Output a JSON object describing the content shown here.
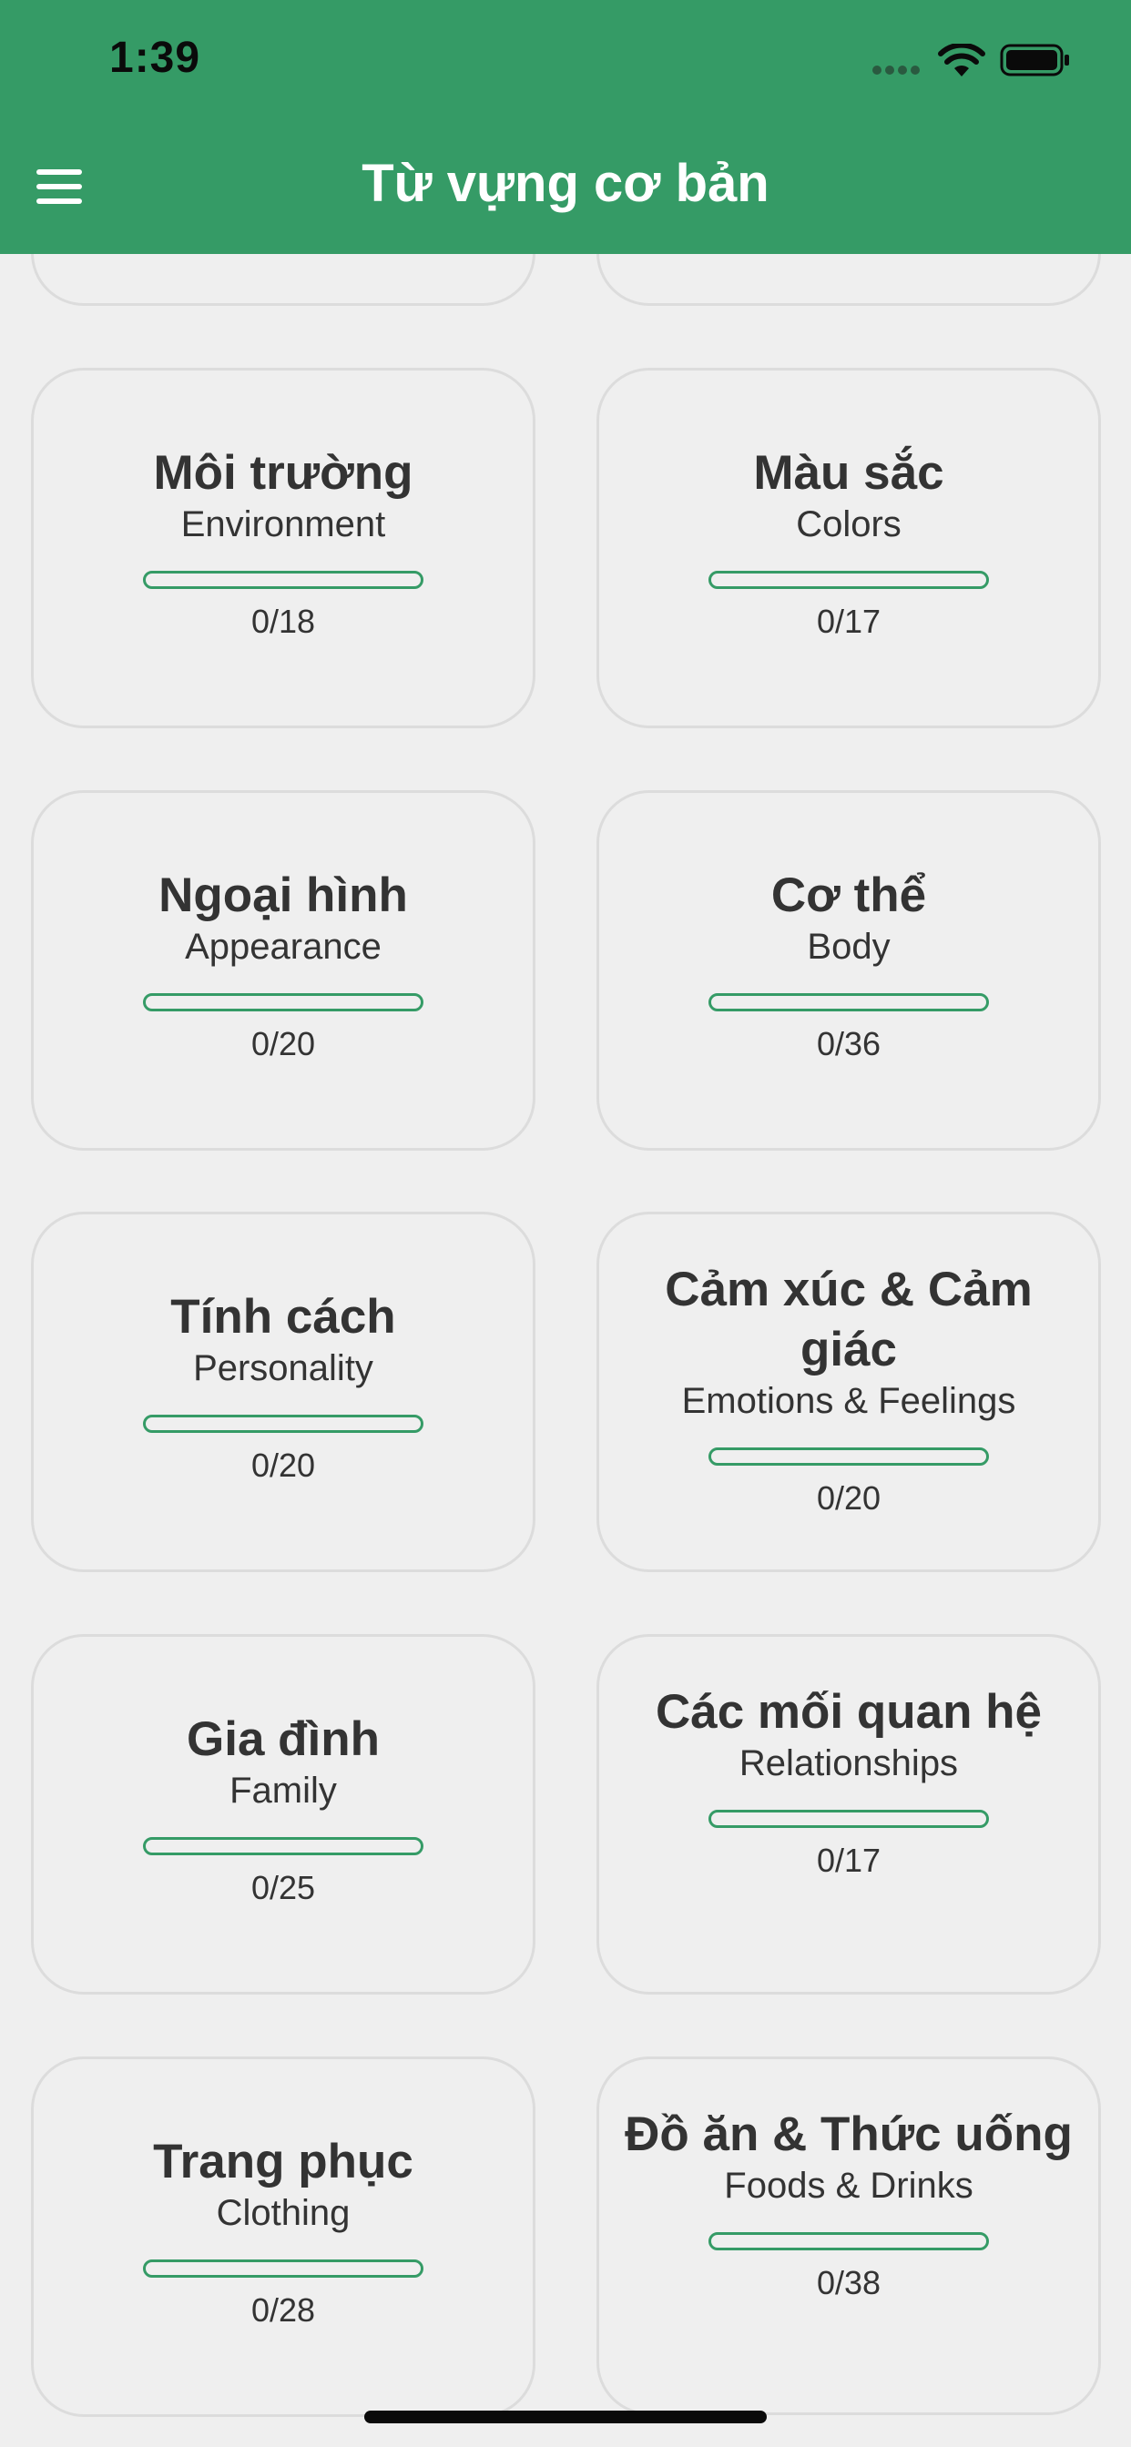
{
  "status_bar": {
    "time": "1:39"
  },
  "header": {
    "title": "Từ vựng cơ bản",
    "background": "#359b66",
    "menu_icon": "hamburger-menu-icon"
  },
  "accent_color": "#359b66",
  "categories": [
    {
      "title": "Môi trường",
      "subtitle": "Environment",
      "count": "0/18",
      "progress": 0
    },
    {
      "title": "Màu sắc",
      "subtitle": "Colors",
      "count": "0/17",
      "progress": 0
    },
    {
      "title": "Ngoại hình",
      "subtitle": "Appearance",
      "count": "0/20",
      "progress": 0
    },
    {
      "title": "Cơ thể",
      "subtitle": "Body",
      "count": "0/36",
      "progress": 0
    },
    {
      "title": "Tính cách",
      "subtitle": "Personality",
      "count": "0/20",
      "progress": 0
    },
    {
      "title": "Cảm xúc & Cảm giác",
      "subtitle": "Emotions & Feelings",
      "count": "0/20",
      "progress": 0
    },
    {
      "title": "Gia đình",
      "subtitle": "Family",
      "count": "0/25",
      "progress": 0
    },
    {
      "title": "Các mối quan hệ",
      "subtitle": "Relationships",
      "count": "0/17",
      "progress": 0
    },
    {
      "title": "Trang phục",
      "subtitle": "Clothing",
      "count": "0/28",
      "progress": 0
    },
    {
      "title": "Đồ ăn & Thức uống",
      "subtitle": "Foods & Drinks",
      "count": "0/38",
      "progress": 0
    }
  ]
}
